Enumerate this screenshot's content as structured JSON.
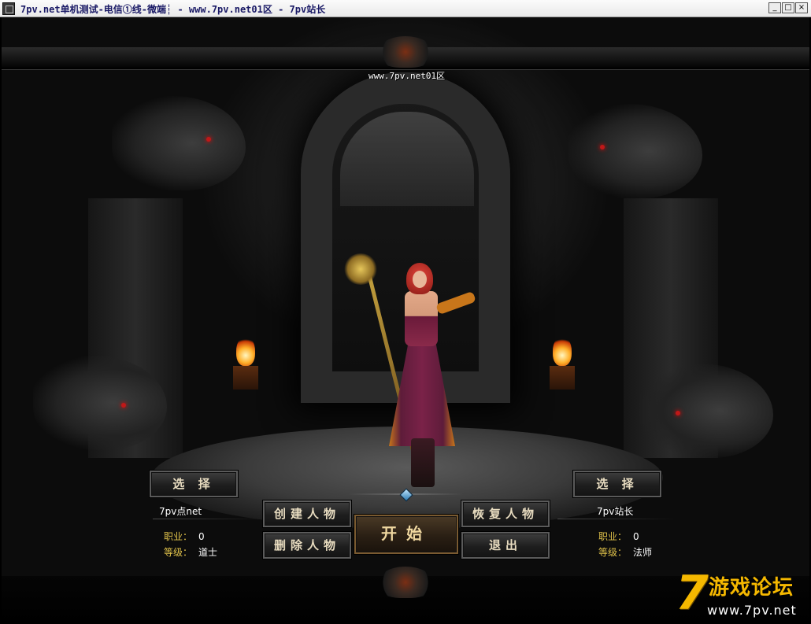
{
  "window": {
    "title": "7pv.net单机测试-电信①线-微端┆ - www.7pv.net01区 - 7pv站长",
    "minimize": "_",
    "maximize": "□",
    "close": "×"
  },
  "scene": {
    "server_label": "www.7pv.net01区"
  },
  "left_slot": {
    "select_label": "选 择",
    "name": "7pv点net",
    "class_label": "职业：",
    "class_value": "0",
    "level_label": "等级：",
    "level_value": "道士"
  },
  "right_slot": {
    "select_label": "选 择",
    "name": "7pv站长",
    "class_label": "职业：",
    "class_value": "0",
    "level_label": "等级：",
    "level_value": "法师"
  },
  "buttons": {
    "create": "创建人物",
    "delete": "删除人物",
    "start": "开始",
    "restore": "恢复人物",
    "exit": "退出"
  },
  "watermark": {
    "digit": "7",
    "text": "游戏论坛",
    "url": "www.7pv.net"
  },
  "colors": {
    "label_gold": "#e0c24a",
    "watermark_gold": "#f5b800",
    "title_text": "#1a1a66"
  }
}
